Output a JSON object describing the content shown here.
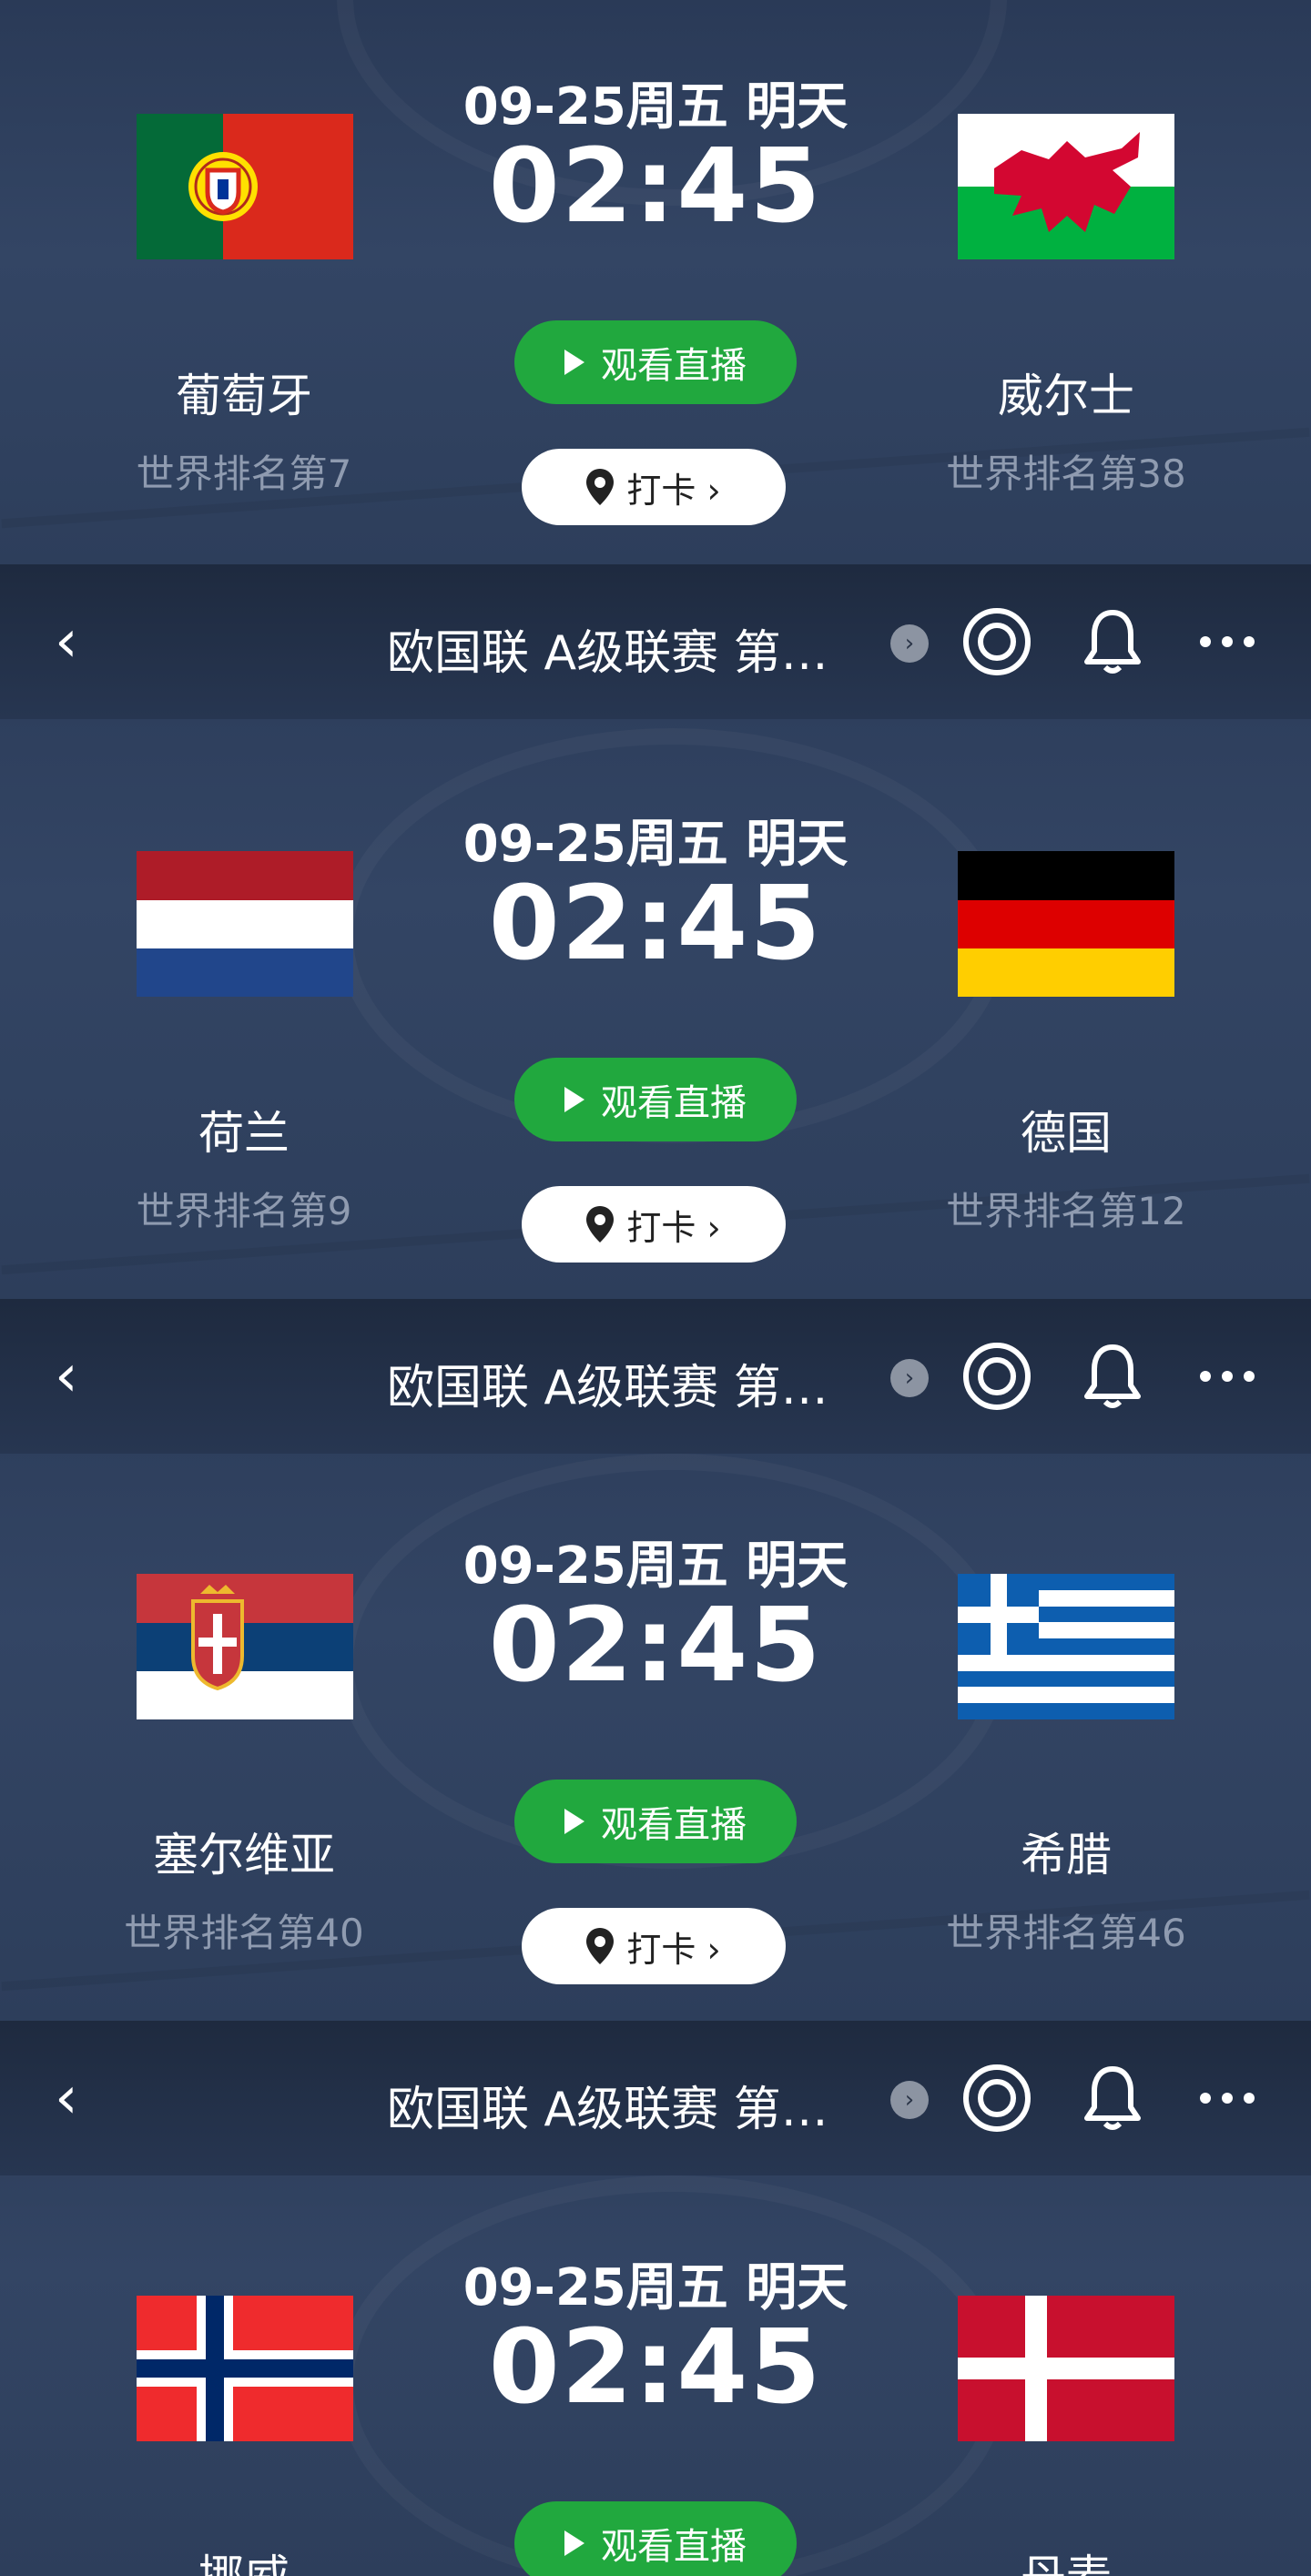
{
  "matches": [
    {
      "date": "09-25周五 明天",
      "time": "02:45",
      "home": {
        "name": "葡萄牙",
        "rank": "世界排名第7"
      },
      "away": {
        "name": "威尔士",
        "rank": "世界排名第38"
      }
    },
    {
      "date": "09-25周五 明天",
      "time": "02:45",
      "home": {
        "name": "荷兰",
        "rank": "世界排名第9"
      },
      "away": {
        "name": "德国",
        "rank": "世界排名第12"
      }
    },
    {
      "date": "09-25周五 明天",
      "time": "02:45",
      "home": {
        "name": "塞尔维亚",
        "rank": "世界排名第40"
      },
      "away": {
        "name": "希腊",
        "rank": "世界排名第46"
      }
    },
    {
      "date": "09-25周五 明天",
      "time": "02:45",
      "home": {
        "name": "挪威",
        "rank": ""
      },
      "away": {
        "name": "丹麦",
        "rank": ""
      }
    }
  ],
  "buttons": {
    "watch": "观看直播",
    "checkin": "打卡 ›"
  },
  "nav": {
    "title": "欧国联 A级联赛 第…",
    "back_glyph": "‹",
    "chevron": "›"
  },
  "colors": {
    "watch_green": "#21a83e",
    "background": "#2b3b57"
  }
}
